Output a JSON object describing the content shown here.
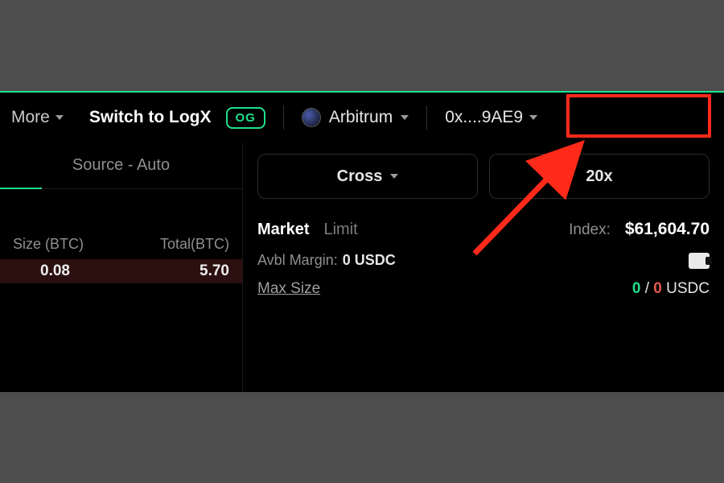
{
  "topbar": {
    "more_label": "More",
    "switch_label": "Switch to LogX",
    "og_badge": "OG",
    "network_name": "Arbitrum",
    "wallet_address": "0x....9AE9"
  },
  "left": {
    "source_label": "Source - Auto",
    "col_size": "Size (BTC)",
    "col_total": "Total(BTC)",
    "row": {
      "size": "0.08",
      "total": "5.70"
    }
  },
  "order": {
    "margin_mode": "Cross",
    "leverage": "20x",
    "tab_market": "Market",
    "tab_limit": "Limit",
    "index_label": "Index:",
    "index_value": "$61,604.70",
    "avbl_label": "Avbl Margin:",
    "avbl_value": "0 USDC",
    "maxsize_label": "Max Size",
    "maxsize_long": "0",
    "maxsize_sep": " / ",
    "maxsize_short": "0",
    "maxsize_unit": " USDC"
  }
}
